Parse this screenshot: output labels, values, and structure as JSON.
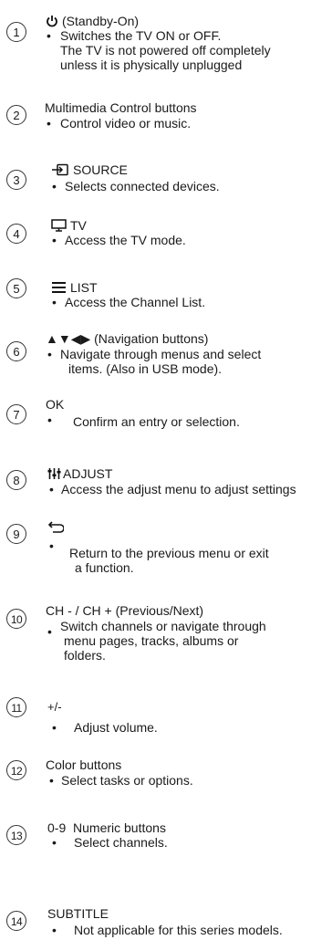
{
  "items": [
    {
      "n": "1",
      "title": "(Standby-On)",
      "lines": [
        "Switches the TV ON or OFF.",
        "The TV is not powered off completely",
        "unless it is physically unplugged"
      ]
    },
    {
      "n": "2",
      "title": "Multimedia Control buttons",
      "lines": [
        "Control video or music."
      ]
    },
    {
      "n": "3",
      "title": "SOURCE",
      "lines": [
        "Selects connected devices."
      ]
    },
    {
      "n": "4",
      "title": "TV",
      "lines": [
        "Access the TV mode."
      ]
    },
    {
      "n": "5",
      "title": "LIST",
      "lines": [
        "Access the Channel List."
      ]
    },
    {
      "n": "6",
      "title": "▲▼◀▶ (Navigation buttons)",
      "lines": [
        "Navigate through menus and select",
        "items. (Also in USB mode)."
      ]
    },
    {
      "n": "7",
      "title": "OK",
      "lines": [
        "Confirm an entry or selection."
      ]
    },
    {
      "n": "8",
      "title": "ADJUST",
      "lines": [
        "Access the adjust menu to adjust settings"
      ]
    },
    {
      "n": "9",
      "title": "",
      "lines": [
        "Return to the previous menu or exit",
        "a function."
      ]
    },
    {
      "n": "10",
      "title": "CH - / CH + (Previous/Next)",
      "lines": [
        "Switch channels or navigate through",
        "menu pages, tracks, albums or",
        "folders."
      ]
    },
    {
      "n": "11",
      "title": "+/-",
      "lines": [
        "Adjust volume."
      ]
    },
    {
      "n": "12",
      "title": "Color buttons",
      "lines": [
        "Select tasks or options."
      ]
    },
    {
      "n": "13",
      "title": "0-9  Numeric buttons",
      "lines": [
        "Select channels."
      ]
    },
    {
      "n": "14",
      "title": "SUBTITLE",
      "lines": [
        "Not applicable for this series models."
      ]
    }
  ],
  "bullet_char": "•",
  "icons": {
    "1": "power-icon",
    "3": "source-input-icon",
    "4": "tv-icon",
    "5": "list-icon",
    "8": "adjust-sliders-icon",
    "9": "back-arrow-icon"
  }
}
